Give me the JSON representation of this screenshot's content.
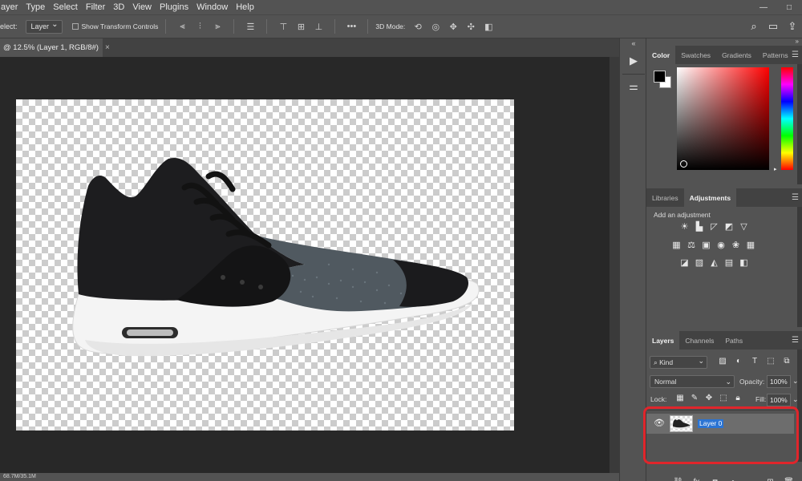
{
  "menu": [
    "ayer",
    "Type",
    "Select",
    "Filter",
    "3D",
    "View",
    "Plugins",
    "Window",
    "Help"
  ],
  "window_controls": [
    "—",
    "□"
  ],
  "options_bar": {
    "select_label": "elect:",
    "select_value": "Layer",
    "show_transform_label": "Show Transform Controls",
    "mode_3d_label": "3D Mode:"
  },
  "document_tab": {
    "title": "@ 12.5% (Layer 1, RGB/8#)",
    "close": "×"
  },
  "status": {
    "doc_size": "68.7M/35.1M"
  },
  "color_panel": {
    "tabs": [
      "Color",
      "Swatches",
      "Gradients",
      "Patterns"
    ],
    "active_tab": "Color",
    "foreground": "#000000",
    "background": "#ffffff"
  },
  "adjustments_panel": {
    "tabs": [
      "Libraries",
      "Adjustments"
    ],
    "active_tab": "Adjustments",
    "title": "Add an adjustment"
  },
  "layers_panel": {
    "tabs": [
      "Layers",
      "Channels",
      "Paths"
    ],
    "active_tab": "Layers",
    "filter_kind": "Kind",
    "blend_mode": "Normal",
    "opacity_label": "Opacity:",
    "opacity_value": "100%",
    "lock_label": "Lock:",
    "fill_label": "Fill:",
    "fill_value": "100%",
    "layers": [
      {
        "name": "Layer 0",
        "visible": true,
        "selected": true
      }
    ]
  },
  "highlight_color": "#e0252b"
}
